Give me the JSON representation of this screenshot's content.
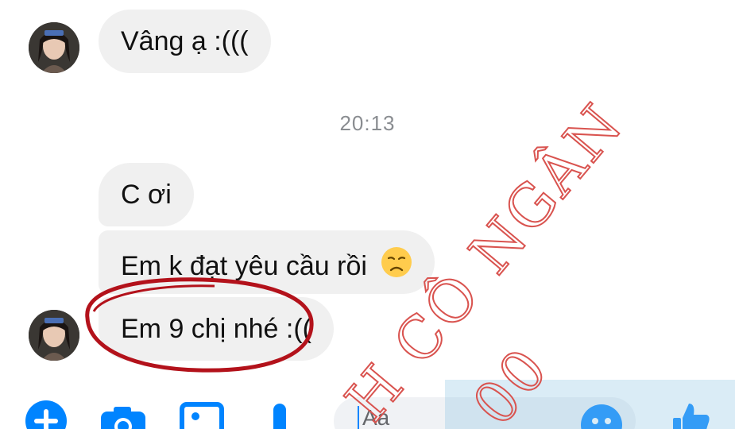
{
  "colors": {
    "accent": "#0084ff",
    "bubble": "#f0f0f0",
    "annotation": "#b3121b",
    "watermark": "#d9534f"
  },
  "messages_top": [
    {
      "text": "Vâng ạ :((("
    }
  ],
  "timestamp": "20:13",
  "messages_bottom": [
    {
      "text": "C ơi"
    },
    {
      "text": "Em k đạt yêu cầu rồi",
      "emoji": "disappointed-face"
    },
    {
      "text": "Em 9 chị nhé :(("
    }
  ],
  "composer": {
    "placeholder": "Aa",
    "icons": [
      "plus-icon",
      "camera-icon",
      "image-icon",
      "microphone-icon",
      "emoji-icon",
      "like-icon"
    ]
  },
  "watermark": {
    "line1": "H CÔ NGÂN",
    "line2": "00"
  }
}
